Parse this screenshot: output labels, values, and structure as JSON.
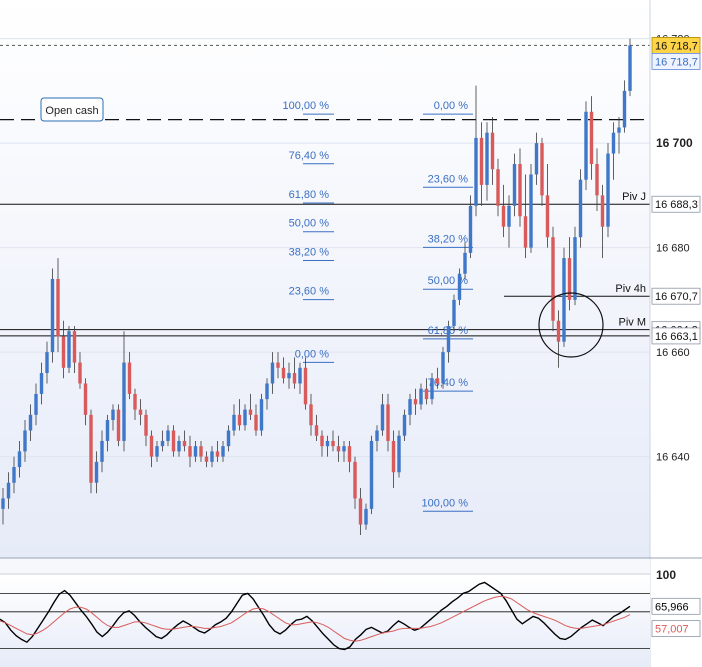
{
  "chart_data": [
    {
      "type": "candlestick",
      "ylim": [
        16625,
        16720.5
      ],
      "y_ticks": [
        {
          "value": 16720,
          "label": "16 720"
        },
        {
          "value": 16700,
          "label": "16 700"
        },
        {
          "value": 16680,
          "label": "16 680"
        },
        {
          "value": 16660,
          "label": "16 660"
        },
        {
          "value": 16640,
          "label": "16 640"
        }
      ],
      "price_tags": [
        {
          "value": 16718.7,
          "label": "16 718,7",
          "kind": "last-highlight"
        },
        {
          "value": 16718.7,
          "label": "16 718,7",
          "kind": "last"
        },
        {
          "value": 16688.3,
          "label": "16 688,3",
          "kind": "level"
        },
        {
          "value": 16670.7,
          "label": "16 670,7",
          "kind": "level"
        },
        {
          "value": 16664.3,
          "label": "16 664,3",
          "kind": "level"
        },
        {
          "value": 16663.1,
          "label": "16 663,1",
          "kind": "level"
        }
      ],
      "levels": [
        {
          "name": "Piv J",
          "value": 16688.3
        },
        {
          "name": "Piv 4h",
          "value": 16670.7
        },
        {
          "name": "Piv M",
          "value": 16664.3
        },
        {
          "name": "",
          "value": 16663.1
        }
      ],
      "open_cash": {
        "label": "Open cash",
        "value": 16704.5
      },
      "fib_left": [
        {
          "label": "100,00 %",
          "value": 16706.5
        },
        {
          "label": "76,40 %",
          "value": 16697
        },
        {
          "label": "61,80 %",
          "value": 16689.5
        },
        {
          "label": "50,00 %",
          "value": 16684
        },
        {
          "label": "38,20 %",
          "value": 16678.5
        },
        {
          "label": "23,60 %",
          "value": 16671
        },
        {
          "label": "0,00 %",
          "value": 16659
        }
      ],
      "fib_right": [
        {
          "label": "0,00 %",
          "value": 16706.5
        },
        {
          "label": "23,60 %",
          "value": 16692.5
        },
        {
          "label": "38,20 %",
          "value": 16681
        },
        {
          "label": "50,00 %",
          "value": 16673
        },
        {
          "label": "61,80 %",
          "value": 16663.5
        },
        {
          "label": "76,40 %",
          "value": 16653.5
        },
        {
          "label": "100,00 %",
          "value": 16630.5
        }
      ],
      "candles": [
        [
          16630,
          16634,
          16627,
          16632
        ],
        [
          16632,
          16637,
          16630,
          16635
        ],
        [
          16635,
          16640,
          16633,
          16638
        ],
        [
          16638,
          16643,
          16636,
          16641
        ],
        [
          16641,
          16647,
          16639,
          16645
        ],
        [
          16645,
          16650,
          16643,
          16648
        ],
        [
          16648,
          16654,
          16646,
          16652
        ],
        [
          16652,
          16658,
          16650,
          16656
        ],
        [
          16656,
          16662,
          16654,
          16660
        ],
        [
          16660,
          16676,
          16658,
          16674
        ],
        [
          16674,
          16678,
          16660,
          16663
        ],
        [
          16663,
          16666,
          16655,
          16657
        ],
        [
          16657,
          16665,
          16656,
          16664
        ],
        [
          16664,
          16665,
          16656,
          16658
        ],
        [
          16658,
          16660,
          16653,
          16654
        ],
        [
          16654,
          16655,
          16646,
          16648
        ],
        [
          16648,
          16649,
          16633,
          16635
        ],
        [
          16635,
          16641,
          16633,
          16639
        ],
        [
          16639,
          16645,
          16637,
          16643
        ],
        [
          16643,
          16648,
          16641,
          16647
        ],
        [
          16647,
          16650,
          16645,
          16649
        ],
        [
          16649,
          16650,
          16642,
          16643
        ],
        [
          16643,
          16664,
          16641,
          16658
        ],
        [
          16658,
          16660,
          16651,
          16652
        ],
        [
          16652,
          16653,
          16647,
          16649
        ],
        [
          16649,
          16651,
          16646,
          16648
        ],
        [
          16648,
          16649,
          16642,
          16644
        ],
        [
          16644,
          16645,
          16638,
          16640
        ],
        [
          16640,
          16643,
          16639,
          16642
        ],
        [
          16642,
          16645,
          16641,
          16643
        ],
        [
          16643,
          16646,
          16642,
          16645
        ],
        [
          16645,
          16646,
          16640,
          16641
        ],
        [
          16641,
          16644,
          16640,
          16643
        ],
        [
          16643,
          16645,
          16641,
          16642
        ],
        [
          16642,
          16644,
          16638,
          16640
        ],
        [
          16640,
          16643,
          16639,
          16642
        ],
        [
          16642,
          16643,
          16639,
          16640
        ],
        [
          16640,
          16641,
          16638,
          16639
        ],
        [
          16639,
          16642,
          16638,
          16641
        ],
        [
          16641,
          16643,
          16639,
          16640
        ],
        [
          16640,
          16643,
          16639,
          16642
        ],
        [
          16642,
          16646,
          16641,
          16645
        ],
        [
          16645,
          16650,
          16644,
          16648
        ],
        [
          16648,
          16651,
          16645,
          16646
        ],
        [
          16646,
          16650,
          16645,
          16649
        ],
        [
          16649,
          16652,
          16647,
          16648
        ],
        [
          16648,
          16650,
          16644,
          16645
        ],
        [
          16645,
          16652,
          16644,
          16651
        ],
        [
          16651,
          16655,
          16649,
          16654
        ],
        [
          16654,
          16660,
          16652,
          16658
        ],
        [
          16658,
          16660,
          16655,
          16657
        ],
        [
          16657,
          16659,
          16654,
          16655
        ],
        [
          16655,
          16658,
          16653,
          16656
        ],
        [
          16656,
          16659,
          16653,
          16654
        ],
        [
          16654,
          16658,
          16652,
          16657
        ],
        [
          16657,
          16659,
          16649,
          16650
        ],
        [
          16650,
          16652,
          16644,
          16646
        ],
        [
          16646,
          16648,
          16643,
          16644
        ],
        [
          16644,
          16645,
          16640,
          16642
        ],
        [
          16642,
          16644,
          16640,
          16643
        ],
        [
          16643,
          16645,
          16641,
          16642
        ],
        [
          16642,
          16644,
          16639,
          16641
        ],
        [
          16641,
          16643,
          16639,
          16642
        ],
        [
          16642,
          16643,
          16637,
          16639
        ],
        [
          16639,
          16640,
          16630,
          16632
        ],
        [
          16632,
          16634,
          16625,
          16627
        ],
        [
          16627,
          16631,
          16626,
          16630
        ],
        [
          16630,
          16644,
          16629,
          16643
        ],
        [
          16643,
          16646,
          16641,
          16645
        ],
        [
          16645,
          16652,
          16644,
          16650
        ],
        [
          16650,
          16652,
          16641,
          16643
        ],
        [
          16643,
          16645,
          16634,
          16637
        ],
        [
          16637,
          16645,
          16636,
          16644
        ],
        [
          16644,
          16649,
          16643,
          16648
        ],
        [
          16648,
          16652,
          16646,
          16651
        ],
        [
          16651,
          16653,
          16648,
          16650
        ],
        [
          16650,
          16654,
          16649,
          16653
        ],
        [
          16653,
          16655,
          16650,
          16651
        ],
        [
          16651,
          16656,
          16650,
          16655
        ],
        [
          16655,
          16657,
          16653,
          16654
        ],
        [
          16654,
          16661,
          16653,
          16660
        ],
        [
          16660,
          16666,
          16658,
          16665
        ],
        [
          16665,
          16671,
          16664,
          16670
        ],
        [
          16670,
          16676,
          16669,
          16675
        ],
        [
          16675,
          16681,
          16674,
          16679
        ],
        [
          16679,
          16690,
          16678,
          16688
        ],
        [
          16688,
          16711,
          16686,
          16701
        ],
        [
          16701,
          16704,
          16688,
          16692
        ],
        [
          16692,
          16704,
          16689,
          16702
        ],
        [
          16702,
          16705,
          16692,
          16695
        ],
        [
          16695,
          16697,
          16686,
          16688
        ],
        [
          16688,
          16692,
          16682,
          16684
        ],
        [
          16684,
          16690,
          16680,
          16688
        ],
        [
          16688,
          16698,
          16686,
          16696
        ],
        [
          16696,
          16699,
          16684,
          16686
        ],
        [
          16686,
          16694,
          16678,
          16680
        ],
        [
          16680,
          16696,
          16679,
          16694
        ],
        [
          16694,
          16702,
          16692,
          16700
        ],
        [
          16700,
          16701,
          16688,
          16690
        ],
        [
          16690,
          16696,
          16680,
          16682
        ],
        [
          16682,
          16684,
          16664,
          16666
        ],
        [
          16666,
          16668,
          16657,
          16662
        ],
        [
          16662,
          16680,
          16661,
          16678
        ],
        [
          16678,
          16682,
          16668,
          16670
        ],
        [
          16670,
          16684,
          16669,
          16682
        ],
        [
          16682,
          16695,
          16680,
          16693
        ],
        [
          16693,
          16708,
          16691,
          16706
        ],
        [
          16706,
          16709,
          16693,
          16696
        ],
        [
          16696,
          16699,
          16687,
          16690
        ],
        [
          16690,
          16692,
          16678,
          16684
        ],
        [
          16684,
          16700,
          16682,
          16698
        ],
        [
          16698,
          16704,
          16693,
          16702
        ],
        [
          16702,
          16705,
          16698,
          16703
        ],
        [
          16703,
          16712,
          16702,
          16710
        ],
        [
          16710,
          16720,
          16709,
          16718.7
        ]
      ]
    },
    {
      "type": "line",
      "ylim": [
        0,
        100
      ],
      "y_ticks": [
        {
          "value": 100,
          "label": "100"
        }
      ],
      "reference_lines": [
        80,
        60,
        20
      ],
      "series": [
        {
          "color": "#000000",
          "last": {
            "value": 65.966,
            "label": "65,966"
          },
          "values": [
            52,
            48,
            40,
            34,
            30,
            27,
            33,
            42,
            51,
            60,
            70,
            79,
            83,
            78,
            70,
            62,
            55,
            47,
            38,
            33,
            38,
            45,
            53,
            59,
            61,
            56,
            49,
            43,
            38,
            33,
            31,
            35,
            41,
            46,
            50,
            47,
            43,
            39,
            37,
            41,
            46,
            49,
            53,
            60,
            69,
            78,
            80,
            74,
            65,
            56,
            46,
            39,
            36,
            40,
            46,
            51,
            52,
            55,
            50,
            43,
            36,
            30,
            24,
            20,
            19,
            22,
            30,
            35,
            41,
            43,
            40,
            37,
            39,
            45,
            50,
            47,
            43,
            40,
            42,
            47,
            52,
            57,
            62,
            66,
            71,
            75,
            80,
            82,
            86,
            90,
            92,
            88,
            84,
            80,
            72,
            62,
            52,
            47,
            51,
            55,
            53,
            48,
            42,
            36,
            31,
            30,
            33,
            38,
            43,
            47,
            51,
            48,
            45,
            50,
            55,
            58,
            62,
            66
          ]
        },
        {
          "color": "#d95b5b",
          "last": {
            "value": 57.007,
            "label": "57,007"
          },
          "values": [
            50,
            48,
            45,
            42,
            39,
            36,
            35,
            37,
            40,
            44,
            49,
            54,
            59,
            63,
            65,
            65,
            63,
            59,
            54,
            49,
            45,
            43,
            43,
            45,
            47,
            49,
            49,
            48,
            46,
            44,
            42,
            41,
            41,
            42,
            43,
            44,
            44,
            43,
            42,
            42,
            43,
            44,
            46,
            48,
            52,
            56,
            60,
            63,
            64,
            63,
            60,
            56,
            52,
            48,
            46,
            46,
            47,
            48,
            49,
            48,
            46,
            43,
            39,
            35,
            31,
            29,
            28,
            29,
            31,
            33,
            35,
            37,
            38,
            39,
            41,
            42,
            42,
            42,
            42,
            43,
            44,
            46,
            48,
            51,
            54,
            57,
            60,
            63,
            66,
            69,
            72,
            74,
            76,
            77,
            76,
            74,
            70,
            66,
            62,
            59,
            57,
            55,
            53,
            51,
            48,
            45,
            43,
            42,
            42,
            43,
            44,
            45,
            46,
            48,
            50,
            52,
            54,
            57
          ]
        }
      ]
    }
  ]
}
